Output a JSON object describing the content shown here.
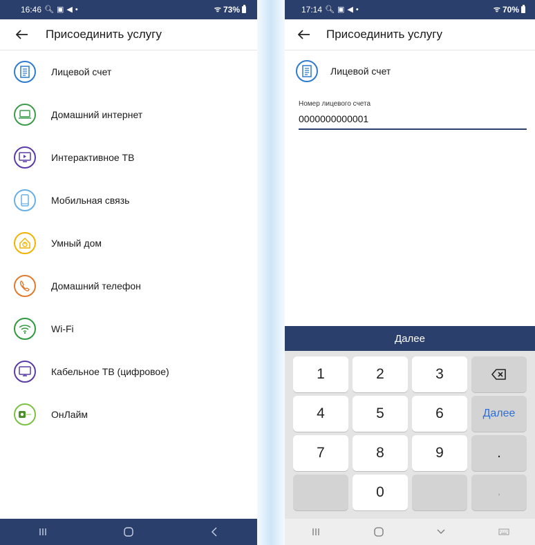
{
  "left": {
    "status": {
      "time": "16:46",
      "battery": "73%"
    },
    "title": "Присоединить услугу",
    "services": [
      {
        "label": "Лицевой счет",
        "icon": "document-icon",
        "color": "#2c7bd0"
      },
      {
        "label": "Домашний интернет",
        "icon": "laptop-icon",
        "color": "#3a9c4a"
      },
      {
        "label": "Интерактивное ТВ",
        "icon": "tv-play-icon",
        "color": "#5a3aa8"
      },
      {
        "label": "Мобильная связь",
        "icon": "smartphone-icon",
        "color": "#6aaee6"
      },
      {
        "label": "Умный дом",
        "icon": "smart-home-icon",
        "color": "#f0b400"
      },
      {
        "label": "Домашний телефон",
        "icon": "phone-handset-icon",
        "color": "#e07b2e"
      },
      {
        "label": "Wi-Fi",
        "icon": "wifi-icon",
        "color": "#2f9a3c"
      },
      {
        "label": "Кабельное ТВ (цифровое)",
        "icon": "monitor-icon",
        "color": "#5a3aa8"
      },
      {
        "label": "ОнЛайм",
        "icon": "onlime-logo-icon",
        "color": "#7ac143"
      }
    ]
  },
  "right": {
    "status": {
      "time": "17:14",
      "battery": "70%"
    },
    "title": "Присоединить услугу",
    "account_label": "Лицевой счет",
    "field_label": "Номер лицевого счета",
    "field_value": "0000000000001",
    "keyboard": {
      "action_bar": "Далее",
      "keys": [
        "1",
        "2",
        "3",
        "⌫",
        "4",
        "5",
        "6",
        "Далее",
        "7",
        "8",
        "9",
        ".",
        "",
        "0",
        "",
        ","
      ]
    }
  },
  "colors": {
    "header": "#2b3f6c",
    "accent": "#2f6fd6"
  }
}
